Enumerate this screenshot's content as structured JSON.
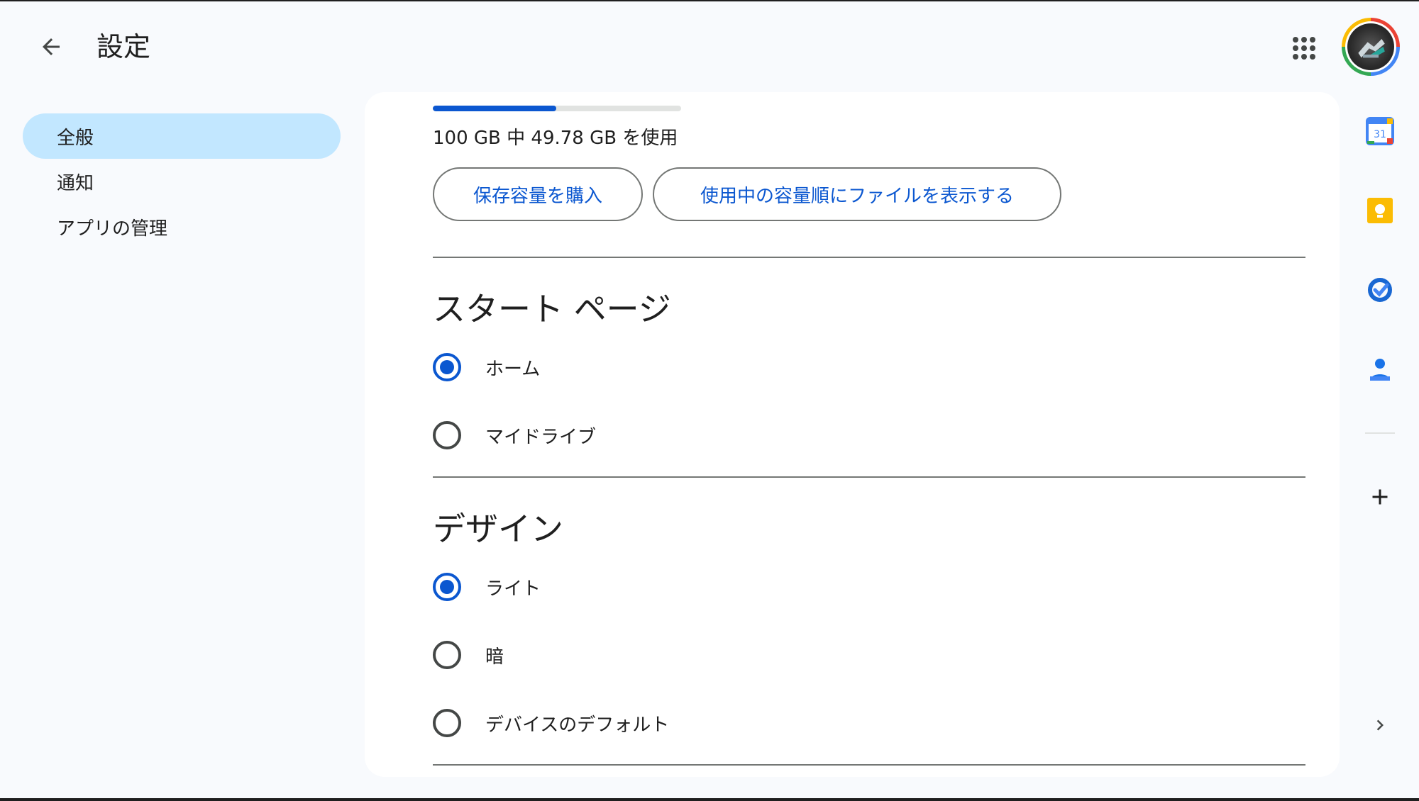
{
  "header": {
    "title": "設定"
  },
  "sidebar": {
    "items": [
      {
        "label": "全般",
        "active": true
      },
      {
        "label": "通知",
        "active": false
      },
      {
        "label": "アプリの管理",
        "active": false
      }
    ]
  },
  "storage": {
    "used_fraction": 0.4978,
    "usage_text": "100 GB 中 49.78 GB を使用",
    "buy_label": "保存容量を購入",
    "show_files_label": "使用中の容量順にファイルを表示する"
  },
  "start_page": {
    "title": "スタート ページ",
    "options": [
      {
        "label": "ホーム",
        "checked": true
      },
      {
        "label": "マイドライブ",
        "checked": false
      }
    ]
  },
  "design": {
    "title": "デザイン",
    "options": [
      {
        "label": "ライト",
        "checked": true
      },
      {
        "label": "暗",
        "checked": false
      },
      {
        "label": "デバイスのデフォルト",
        "checked": false
      }
    ]
  },
  "side_rail": {
    "calendar_day": "31",
    "icons": [
      "calendar-icon",
      "keep-icon",
      "tasks-icon",
      "contacts-icon",
      "add-icon",
      "chevron-right-icon"
    ]
  },
  "colors": {
    "accent": "#0b57d0",
    "active_nav": "#c2e7ff",
    "background": "#f8fafd",
    "keep_yellow": "#fbbc04",
    "calendar_blue": "#4285f4"
  }
}
